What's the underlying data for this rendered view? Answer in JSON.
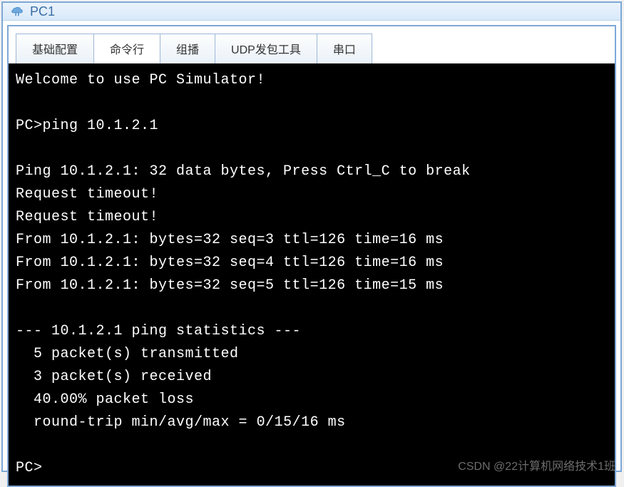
{
  "window": {
    "title": "PC1"
  },
  "tabs": [
    {
      "label": "基础配置"
    },
    {
      "label": "命令行"
    },
    {
      "label": "组播"
    },
    {
      "label": "UDP发包工具"
    },
    {
      "label": "串口"
    }
  ],
  "terminal": {
    "lines": [
      "Welcome to use PC Simulator!",
      "",
      "PC>ping 10.1.2.1",
      "",
      "Ping 10.1.2.1: 32 data bytes, Press Ctrl_C to break",
      "Request timeout!",
      "Request timeout!",
      "From 10.1.2.1: bytes=32 seq=3 ttl=126 time=16 ms",
      "From 10.1.2.1: bytes=32 seq=4 ttl=126 time=16 ms",
      "From 10.1.2.1: bytes=32 seq=5 ttl=126 time=15 ms",
      "",
      "--- 10.1.2.1 ping statistics ---",
      "  5 packet(s) transmitted",
      "  3 packet(s) received",
      "  40.00% packet loss",
      "  round-trip min/avg/max = 0/15/16 ms",
      "",
      "PC>"
    ]
  },
  "watermark": "CSDN @22计算机网络技术1班"
}
